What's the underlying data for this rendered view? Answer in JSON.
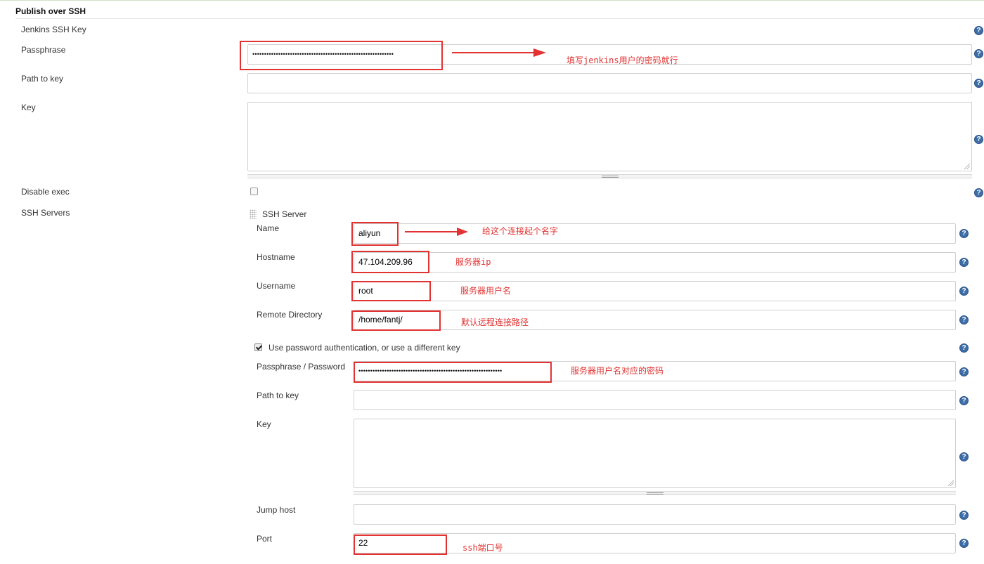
{
  "section": {
    "title": "Publish over SSH"
  },
  "global": {
    "jenkins_ssh_key_label": "Jenkins SSH Key",
    "passphrase_label": "Passphrase",
    "passphrase_value": "••••••••••••••••••••••••••••••••••••••••••••••••••••••••••••",
    "path_to_key_label": "Path to key",
    "path_to_key_value": "",
    "key_label": "Key",
    "key_value": "",
    "disable_exec_label": "Disable exec",
    "disable_exec_checked": false,
    "ssh_servers_label": "SSH Servers"
  },
  "server": {
    "header": "SSH Server",
    "name_label": "Name",
    "name_value": "aliyun",
    "hostname_label": "Hostname",
    "hostname_value": "47.104.209.96",
    "username_label": "Username",
    "username_value": "root",
    "remote_dir_label": "Remote Directory",
    "remote_dir_value": "/home/fantj/",
    "use_password_label": "Use password authentication, or use a different key",
    "use_password_checked": true,
    "password_label": "Passphrase / Password",
    "password_value": "•••••••••••••••••••••••••••••••••••••••••••••••••••••••••••••",
    "path_to_key_label": "Path to key",
    "path_to_key_value": "",
    "key_label": "Key",
    "key_value": "",
    "jump_host_label": "Jump host",
    "jump_host_value": "",
    "port_label": "Port",
    "port_value": "22"
  },
  "annotations": {
    "passphrase": "填写jenkins用户的密码就行",
    "name": "给这个连接起个名字",
    "hostname": "服务器ip",
    "username": "服务器用户名",
    "remote_dir": "默认远程连接路径",
    "password": "服务器用户名对应的密码",
    "port": "ssh端口号"
  },
  "help_icon_glyph": "?",
  "colors": {
    "annotation_red": "#e23232",
    "help_blue": "#3d6ea8"
  }
}
